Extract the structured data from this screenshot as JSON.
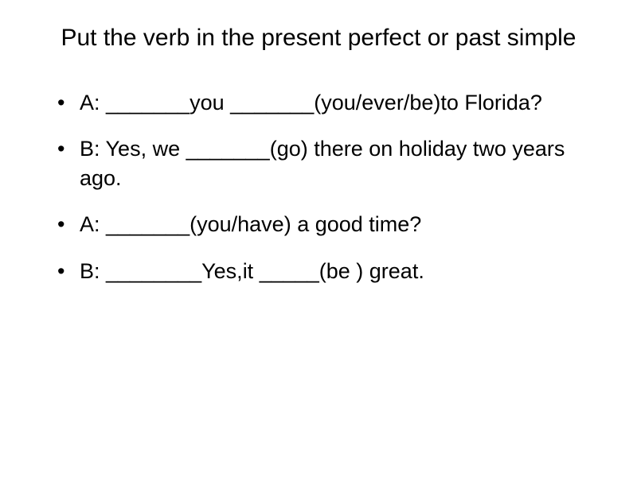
{
  "title": "Put the verb in the present perfect or past simple",
  "items": [
    "A: _______you _______(you/ever/be)to Florida?",
    "B: Yes, we _______(go) there on holiday two years ago.",
    "A: _______(you/have) a good time?",
    "B: ________Yes,it _____(be ) great."
  ]
}
